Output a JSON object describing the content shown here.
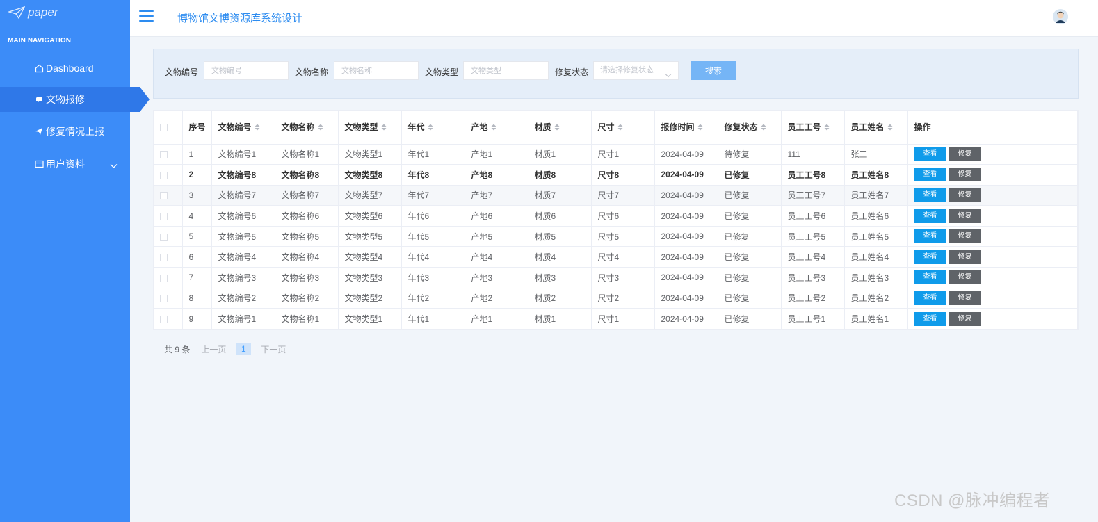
{
  "logo": {
    "text": "paper"
  },
  "sidebar": {
    "title": "MAIN NAVIGATION",
    "items": [
      {
        "label": "Dashboard",
        "icon": "home-icon"
      },
      {
        "label": "文物报修",
        "icon": "message-icon",
        "active": true
      },
      {
        "label": "修复情况上报",
        "icon": "send-icon"
      },
      {
        "label": "用户资料",
        "icon": "card-icon",
        "expandable": true
      }
    ]
  },
  "header": {
    "title": "博物馆文博资源库系统设计"
  },
  "search": {
    "fields": [
      {
        "label": "文物编号",
        "placeholder": "文物编号"
      },
      {
        "label": "文物名称",
        "placeholder": "文物名称"
      },
      {
        "label": "文物类型",
        "placeholder": "文物类型"
      },
      {
        "label": "修复状态",
        "placeholder": "请选择修复状态"
      }
    ],
    "button": "搜索"
  },
  "table": {
    "headers": [
      "序号",
      "文物编号",
      "文物名称",
      "文物类型",
      "年代",
      "产地",
      "材质",
      "尺寸",
      "报修时间",
      "修复状态",
      "员工工号",
      "员工姓名",
      "操作"
    ],
    "rows": [
      [
        "1",
        "文物编号1",
        "文物名称1",
        "文物类型1",
        "年代1",
        "产地1",
        "材质1",
        "尺寸1",
        "2024-04-09",
        "待修复",
        "111",
        "张三"
      ],
      [
        "2",
        "文物编号8",
        "文物名称8",
        "文物类型8",
        "年代8",
        "产地8",
        "材质8",
        "尺寸8",
        "2024-04-09",
        "已修复",
        "员工工号8",
        "员工姓名8"
      ],
      [
        "3",
        "文物编号7",
        "文物名称7",
        "文物类型7",
        "年代7",
        "产地7",
        "材质7",
        "尺寸7",
        "2024-04-09",
        "已修复",
        "员工工号7",
        "员工姓名7"
      ],
      [
        "4",
        "文物编号6",
        "文物名称6",
        "文物类型6",
        "年代6",
        "产地6",
        "材质6",
        "尺寸6",
        "2024-04-09",
        "已修复",
        "员工工号6",
        "员工姓名6"
      ],
      [
        "5",
        "文物编号5",
        "文物名称5",
        "文物类型5",
        "年代5",
        "产地5",
        "材质5",
        "尺寸5",
        "2024-04-09",
        "已修复",
        "员工工号5",
        "员工姓名5"
      ],
      [
        "6",
        "文物编号4",
        "文物名称4",
        "文物类型4",
        "年代4",
        "产地4",
        "材质4",
        "尺寸4",
        "2024-04-09",
        "已修复",
        "员工工号4",
        "员工姓名4"
      ],
      [
        "7",
        "文物编号3",
        "文物名称3",
        "文物类型3",
        "年代3",
        "产地3",
        "材质3",
        "尺寸3",
        "2024-04-09",
        "已修复",
        "员工工号3",
        "员工姓名3"
      ],
      [
        "8",
        "文物编号2",
        "文物名称2",
        "文物类型2",
        "年代2",
        "产地2",
        "材质2",
        "尺寸2",
        "2024-04-09",
        "已修复",
        "员工工号2",
        "员工姓名2"
      ],
      [
        "9",
        "文物编号1",
        "文物名称1",
        "文物类型1",
        "年代1",
        "产地1",
        "材质1",
        "尺寸1",
        "2024-04-09",
        "已修复",
        "员工工号1",
        "员工姓名1"
      ]
    ],
    "bold_row_index": 1,
    "hover_row_index": 2,
    "actions": {
      "view": "查看",
      "fix": "修复"
    }
  },
  "pagination": {
    "total": "共 9 条",
    "prev": "上一页",
    "current": "1",
    "next": "下一页"
  },
  "watermark": "CSDN @脉冲编程者",
  "colors": {
    "sidebar": "#3c8cf8",
    "accent": "#2d8cf0",
    "view_button": "#0f9bea",
    "fix_button": "#5f6368"
  }
}
